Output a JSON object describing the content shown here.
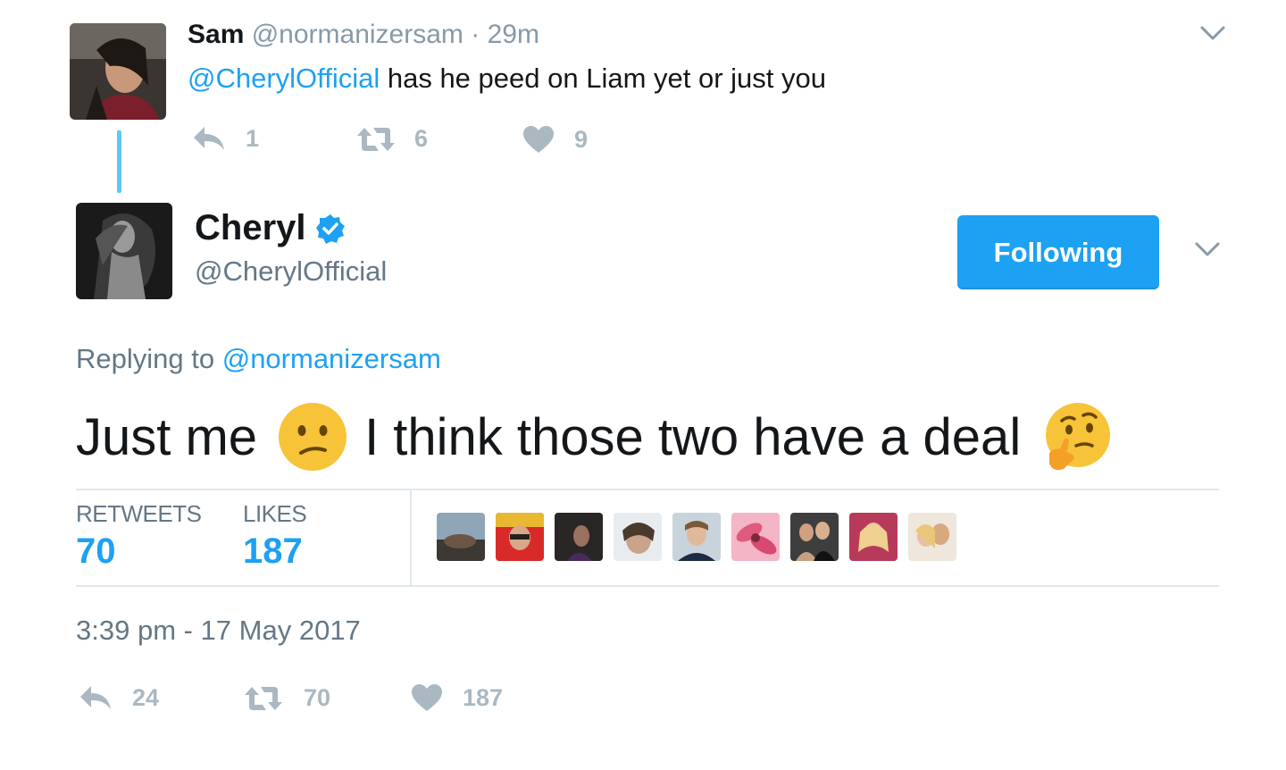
{
  "reply_tweet": {
    "name": "Sam",
    "handle": "@normanizersam",
    "time_sep": "·",
    "time": "29m",
    "mention": "@CherylOfficial",
    "text": " has he peed on Liam yet or just you",
    "actions": {
      "reply_count": "1",
      "retweet_count": "6",
      "like_count": "9"
    }
  },
  "main_tweet": {
    "name": "Cheryl",
    "handle": "@CherylOfficial",
    "follow_label": "Following",
    "replying_prefix": "Replying to",
    "replying_handle": "@normanizersam",
    "text_part1": "Just me",
    "text_part2": "I think those two have a deal",
    "emoji1": "confused-face",
    "emoji2": "thinking-face",
    "stats": {
      "retweets_label": "RETWEETS",
      "retweets_value": "70",
      "likes_label": "LIKES",
      "likes_value": "187"
    },
    "likers_count_shown": 9,
    "timestamp": "3:39 pm - 17 May 2017",
    "actions": {
      "reply_count": "24",
      "retweet_count": "70",
      "like_count": "187"
    }
  },
  "colors": {
    "accent": "#1da1f2",
    "muted": "#8899a6",
    "action": "#aab8c2",
    "divider": "#e1e8ed",
    "thread_line": "#5cc8f3"
  },
  "icons": [
    "reply-icon",
    "retweet-icon",
    "heart-icon",
    "chevron-down-icon",
    "verified-badge-icon"
  ]
}
